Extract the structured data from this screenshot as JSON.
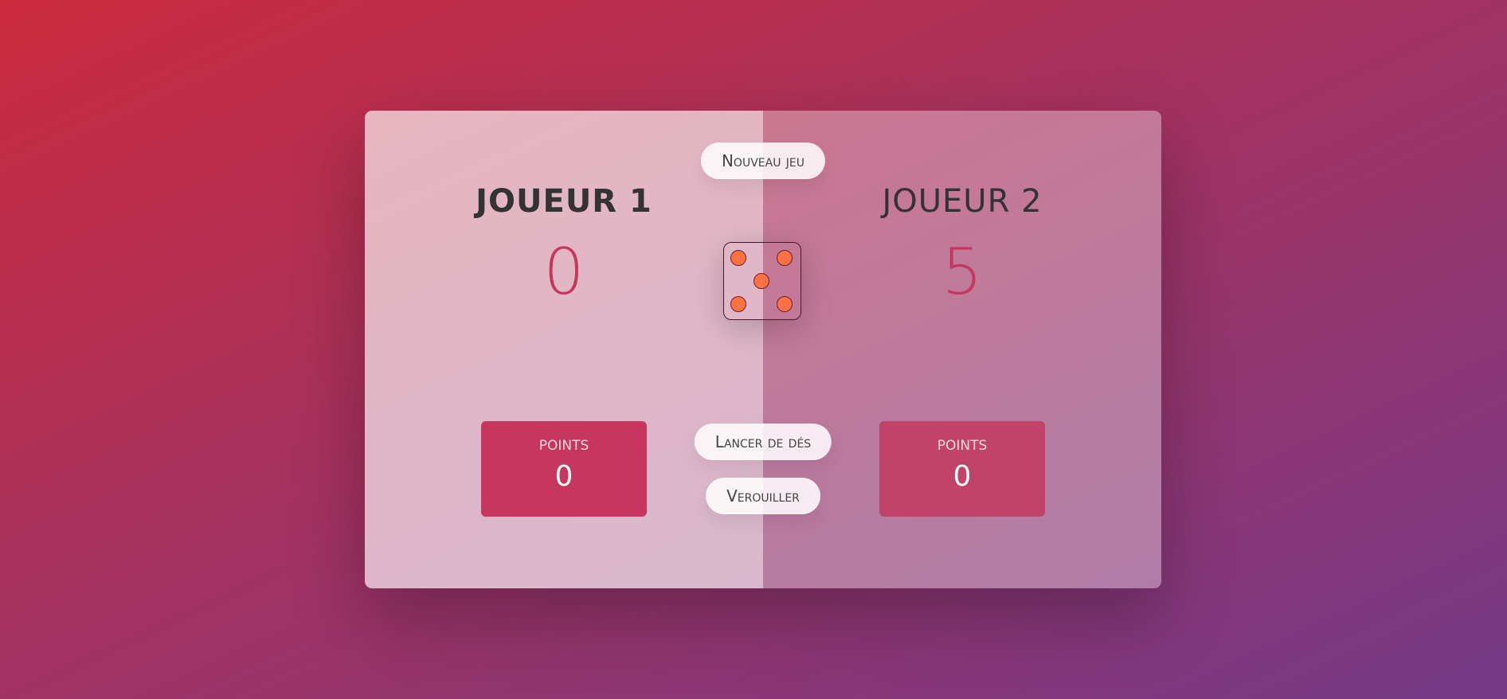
{
  "players": [
    {
      "name": "Joueur 1",
      "score": "0",
      "current_label": "Points",
      "current_score": "0",
      "active": true
    },
    {
      "name": "Joueur 2",
      "score": "5",
      "current_label": "Points",
      "current_score": "0",
      "active": false
    }
  ],
  "buttons": {
    "new_game": "Nouveau jeu",
    "roll": "Lancer de dés",
    "hold": "Verouiller"
  },
  "dice": {
    "value": 5,
    "pip_color": "#ff7043"
  },
  "colors": {
    "accent": "#c7365f",
    "gradient_start": "#cc2b3e",
    "gradient_end": "#753a88"
  }
}
